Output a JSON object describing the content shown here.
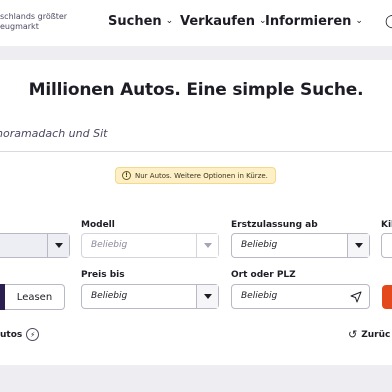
{
  "header": {
    "tagline_line1": "schlands größter",
    "tagline_line2": "eugmarkt",
    "nav": [
      {
        "label": "Suchen"
      },
      {
        "label": "Verkaufen"
      },
      {
        "label": "Informieren"
      }
    ],
    "chevron_icon": "chevron-down-icon"
  },
  "hero": {
    "title": "Millionen Autos. Eine simple Suche."
  },
  "search": {
    "value": "noramadach und Sit"
  },
  "info": {
    "icon": "info-icon",
    "text": "Nur Autos. Weitere Optionen in Kürze."
  },
  "filters": {
    "modell_label": "Modell",
    "modell_value": "Beliebig",
    "erstzulassung_label": "Erstzulassung ab",
    "erstzulassung_value": "Beliebig",
    "km_label_partial": "Kil",
    "preis_label": "Preis bis",
    "preis_value": "Beliebig",
    "ort_label": "Ort oder PLZ",
    "ort_placeholder": "Beliebig"
  },
  "mode_toggle": {
    "leasen_label": "Leasen"
  },
  "footer": {
    "electric_label": "utos",
    "reset_label": "Zurüc"
  },
  "colors": {
    "accent": "#e4491d",
    "toggle_active": "#2a1f4f",
    "info_bg": "#fdf0c6",
    "page_bg": "#eeeef2"
  }
}
